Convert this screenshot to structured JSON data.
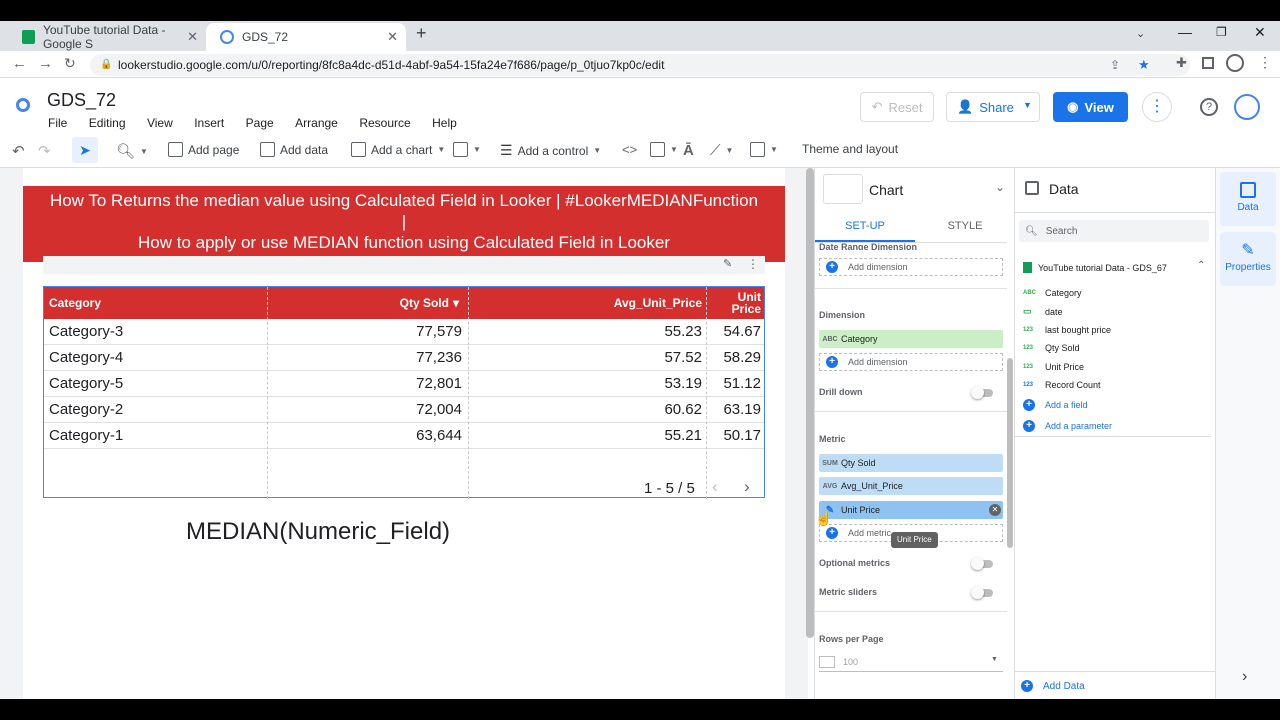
{
  "browser": {
    "tabs": [
      {
        "title": "YouTube tutorial Data - Google S",
        "active": false
      },
      {
        "title": "GDS_72",
        "active": true
      }
    ],
    "url": "lookerstudio.google.com/u/0/reporting/8fc8a4dc-d51d-4abf-9a54-15fa24e7f686/page/p_0tjuo7kp0c/edit"
  },
  "header": {
    "report_title": "GDS_72",
    "menu": [
      "File",
      "Editing",
      "View",
      "Insert",
      "Page",
      "Arrange",
      "Resource",
      "Help"
    ],
    "reset_label": "Reset",
    "share_label": "Share",
    "view_label": "View"
  },
  "toolbar": {
    "add_page": "Add page",
    "add_data": "Add data",
    "add_chart": "Add a chart",
    "add_control": "Add a control",
    "theme_layout": "Theme and layout"
  },
  "canvas": {
    "banner_line1": "How To Returns the median value using Calculated Field in Looker | #LookerMEDIANFunction",
    "banner_line2": "|",
    "banner_line3": "How to apply or use MEDIAN function using Calculated Field in Looker",
    "formula": "MEDIAN(Numeric_Field)",
    "table": {
      "headers": [
        "Category",
        "Qty Sold",
        "Avg_Unit_Price",
        "Unit Price"
      ],
      "sort_indicator": "▾",
      "rows": [
        [
          "Category-3",
          "77,579",
          "55.23",
          "54.67"
        ],
        [
          "Category-4",
          "77,236",
          "57.52",
          "58.29"
        ],
        [
          "Category-5",
          "72,801",
          "53.19",
          "51.12"
        ],
        [
          "Category-2",
          "72,004",
          "60.62",
          "63.19"
        ],
        [
          "Category-1",
          "63,644",
          "55.21",
          "50.17"
        ]
      ],
      "pagination": "1 - 5 / 5"
    }
  },
  "chart_panel": {
    "title": "Chart",
    "tab_setup": "SET-UP",
    "tab_style": "STYLE",
    "date_range_label": "Date Range Dimension",
    "add_dimension": "Add dimension",
    "dimension_label": "Dimension",
    "dimension_chip": {
      "tag": "ABC",
      "name": "Category"
    },
    "drill_down": "Drill down",
    "metric_label": "Metric",
    "metrics": [
      {
        "tag": "SUM",
        "name": "Qty Sold"
      },
      {
        "tag": "AVG",
        "name": "Avg_Unit_Price"
      },
      {
        "tag": "✎",
        "name": "Unit Price"
      }
    ],
    "add_metric": "Add metric",
    "tooltip": "Unit Price",
    "optional_metrics": "Optional metrics",
    "metric_sliders": "Metric sliders",
    "rows_per_page_label": "Rows per Page",
    "rows_per_page_value": "100"
  },
  "data_panel": {
    "title": "Data",
    "search_placeholder": "Search",
    "source": "YouTube tutorial Data - GDS_67",
    "fields": [
      {
        "type": "ABC",
        "name": "Category"
      },
      {
        "type": "▭",
        "name": "date"
      },
      {
        "type": "123",
        "name": "last bought price"
      },
      {
        "type": "123",
        "name": "Qty Sold"
      },
      {
        "type": "123",
        "name": "Unit Price"
      },
      {
        "type": "123",
        "name": "Record Count"
      }
    ],
    "add_field": "Add a field",
    "add_parameter": "Add a parameter",
    "add_data": "Add Data"
  },
  "rail": {
    "data_label": "Data",
    "properties_label": "Properties"
  },
  "colors": {
    "accent": "#1a73e8",
    "banner": "#d32f2f",
    "chip_green": "#cbeec7",
    "chip_blue": "#bfdcf7"
  }
}
